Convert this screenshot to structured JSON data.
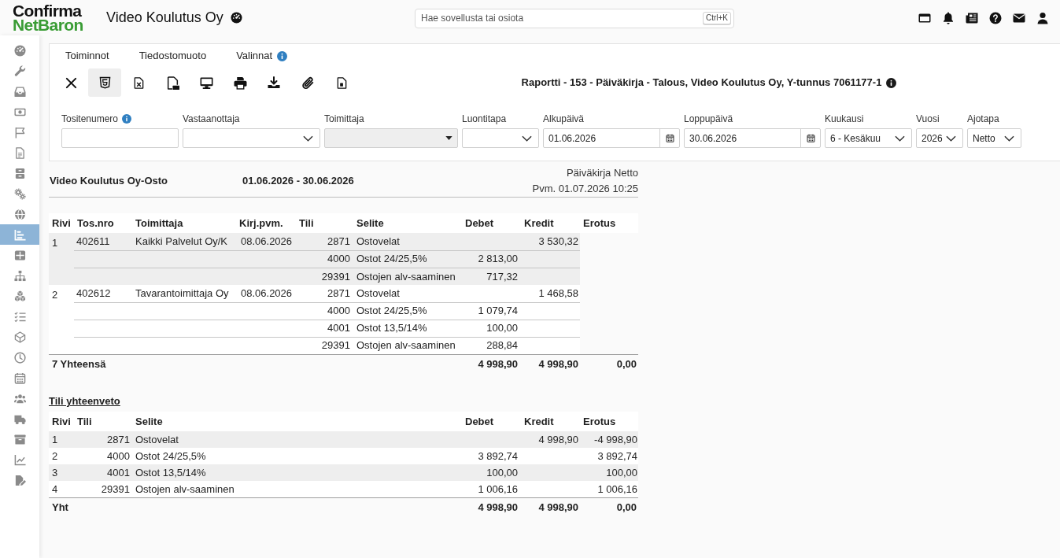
{
  "header": {
    "logo": [
      "Confirma",
      "NetBaron"
    ],
    "company": "Video Koulutus Oy",
    "search": {
      "placeholder": "Hae sovellusta tai osiota",
      "shortcut": "Ctrl+K"
    }
  },
  "sidebar": {
    "items": [
      {
        "selected": false
      },
      {
        "selected": false
      },
      {
        "selected": false
      },
      {
        "selected": false
      },
      {
        "selected": false
      },
      {
        "selected": false
      },
      {
        "selected": false
      },
      {
        "selected": false
      },
      {
        "selected": false
      },
      {
        "selected": true
      },
      {
        "selected": false
      },
      {
        "selected": false
      },
      {
        "selected": false
      },
      {
        "selected": false
      },
      {
        "selected": false
      },
      {
        "selected": false
      },
      {
        "selected": false
      },
      {
        "selected": false
      },
      {
        "selected": false
      },
      {
        "selected": false
      },
      {
        "selected": false
      },
      {
        "selected": false
      }
    ]
  },
  "toolbar": {
    "menus": [
      {
        "label": "Toiminnot",
        "info": false
      },
      {
        "label": "Tiedostomuoto",
        "info": false
      },
      {
        "label": "Valinnat",
        "info": true
      }
    ],
    "actions": [
      {
        "selected": false
      },
      {
        "selected": true
      },
      {
        "selected": false
      },
      {
        "selected": false
      },
      {
        "selected": false
      },
      {
        "selected": false
      },
      {
        "selected": false
      },
      {
        "selected": false
      },
      {
        "selected": false
      }
    ],
    "title": "Raportti - 153 - Päiväkirja - Talous, Video Koulutus Oy, Y-tunnus 7061177-1"
  },
  "filters": [
    {
      "label": "Tositenumero",
      "kind": "text",
      "info": true,
      "disabled": false
    },
    {
      "label": "Vastaanottaja",
      "kind": "select",
      "info": false,
      "disabled": false
    },
    {
      "label": "Toimittaja",
      "kind": "select",
      "info": false,
      "disabled": true
    },
    {
      "label": "Luontitapa",
      "kind": "select",
      "info": false,
      "disabled": false
    },
    {
      "label": "Alkupäivä",
      "kind": "date",
      "info": false,
      "disabled": false,
      "value": "01.06.2026"
    },
    {
      "label": "Loppupäivä",
      "kind": "date",
      "info": false,
      "disabled": false,
      "value": "30.06.2026"
    },
    {
      "label": "Kuukausi",
      "kind": "select",
      "info": false,
      "disabled": false,
      "value": "6 - Kesäkuu"
    },
    {
      "label": "Vuosi",
      "kind": "select",
      "info": false,
      "disabled": false,
      "value": "2026"
    },
    {
      "label": "Ajotapa",
      "kind": "select",
      "info": false,
      "disabled": false,
      "value": "Netto"
    }
  ],
  "report": {
    "company": "Video Koulutus Oy-Osto",
    "period": "01.06.2026 - 30.06.2026",
    "report_name": "Päiväkirja Netto",
    "printed": "Pvm. 01.07.2026 10:25",
    "journal": {
      "columns": [
        "Rivi",
        "Tos.nro",
        "Toimittaja",
        "Kirj.pvm.",
        "Tili",
        "Selite",
        "Debet",
        "Kredit",
        "Erotus"
      ],
      "vouchers": [
        {
          "rivi": "1",
          "tos_nro": "402611",
          "toimittaja": "Kaikki Palvelut Oy/K",
          "kirj_pvm": "08.06.2026",
          "lines": [
            {
              "tili": "2871",
              "selite": "Ostovelat",
              "kredit": "3 530,32"
            },
            {
              "tili": "4000",
              "selite": "Ostot 24/25,5%",
              "debet": "2 813,00"
            },
            {
              "tili": "29391",
              "selite": "Ostojen alv-saaminen",
              "debet": "717,32"
            }
          ]
        },
        {
          "rivi": "2",
          "tos_nro": "402612",
          "toimittaja": "Tavarantoimittaja Oy",
          "kirj_pvm": "08.06.2026",
          "lines": [
            {
              "tili": "2871",
              "selite": "Ostovelat",
              "kredit": "1 468,58"
            },
            {
              "tili": "4000",
              "selite": "Ostot 24/25,5%",
              "debet": "1 079,74"
            },
            {
              "tili": "4001",
              "selite": "Ostot 13,5/14%",
              "debet": "100,00"
            },
            {
              "tili": "29391",
              "selite": "Ostojen alv-saaminen",
              "debet": "288,84"
            }
          ]
        }
      ],
      "total": {
        "label": "7 Yhteensä",
        "debet": "4 998,90",
        "kredit": "4 998,90",
        "erotus": "0,00"
      }
    },
    "summary": {
      "title": "Tili yhteenveto",
      "columns": [
        "Rivi",
        "Tili",
        "Selite",
        "Debet",
        "Kredit",
        "Erotus"
      ],
      "rows": [
        {
          "rivi": "1",
          "tili": "2871",
          "selite": "Ostovelat",
          "kredit": "4 998,90",
          "erotus": "-4 998,90"
        },
        {
          "rivi": "2",
          "tili": "4000",
          "selite": "Ostot 24/25,5%",
          "debet": "3 892,74",
          "erotus": "3 892,74"
        },
        {
          "rivi": "3",
          "tili": "4001",
          "selite": "Ostot 13,5/14%",
          "debet": "100,00",
          "erotus": "100,00"
        },
        {
          "rivi": "4",
          "tili": "29391",
          "selite": "Ostojen alv-saaminen",
          "debet": "1 006,16",
          "erotus": "1 006,16"
        }
      ],
      "total": {
        "label": "Yht",
        "debet": "4 998,90",
        "kredit": "4 998,90",
        "erotus": "0,00"
      }
    }
  }
}
